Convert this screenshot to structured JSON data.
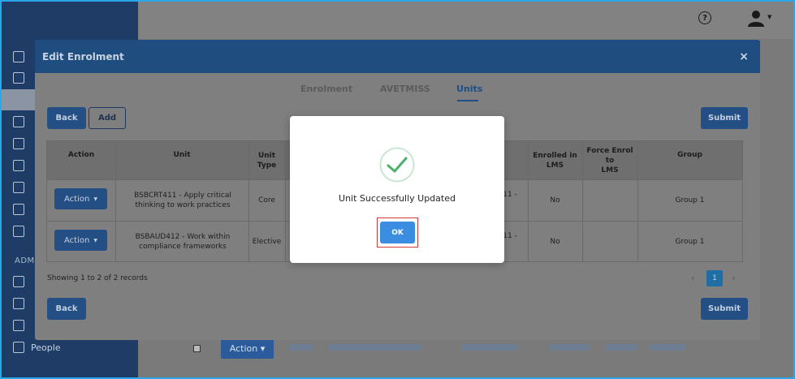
{
  "sidebar": {
    "section_label": "ADMI",
    "people_label": "People"
  },
  "background": {
    "row_action_label": "Action ▾"
  },
  "modal": {
    "title": "Edit Enrolment",
    "close_label": "×",
    "tabs": [
      {
        "label": "Enrolment",
        "active": false
      },
      {
        "label": "AVETMISS",
        "active": false
      },
      {
        "label": "Units",
        "active": true
      }
    ],
    "buttons": {
      "back_top": "Back",
      "add": "Add",
      "submit_top": "Submit",
      "back_bottom": "Back",
      "submit_bottom": "Submit"
    },
    "table": {
      "headers": {
        "action": "Action",
        "unit": "Unit",
        "unit_type": "Unit\nType",
        "enrolled_lms": "Enrolled in\nLMS",
        "force_enrol": "Force Enrol to\nLMS",
        "group": "Group"
      },
      "rows": [
        {
          "action": "Action",
          "unit": "BSBCRT411 - Apply critical thinking to work practices",
          "unit_type": "Core",
          "partial": "11 -",
          "enrolled_lms": "No",
          "force_enrol": "",
          "group": "Group 1"
        },
        {
          "action": "Action",
          "unit": "BSBAUD412 - Work within compliance frameworks",
          "unit_type": "Elective",
          "partial": "11 -",
          "enrolled_lms": "No",
          "force_enrol": "",
          "group": "Group 1"
        }
      ]
    },
    "records_text": "Showing 1 to 2 of 2 records",
    "pagination": {
      "prev": "‹",
      "current": "1",
      "next": "›"
    }
  },
  "dialog": {
    "message": "Unit Successfully Updated",
    "ok_label": "OK",
    "success_color": "#4caf6e",
    "ok_color": "#3a8de0",
    "highlight_color": "#d33b3b"
  },
  "header": {
    "help_label": "?"
  }
}
